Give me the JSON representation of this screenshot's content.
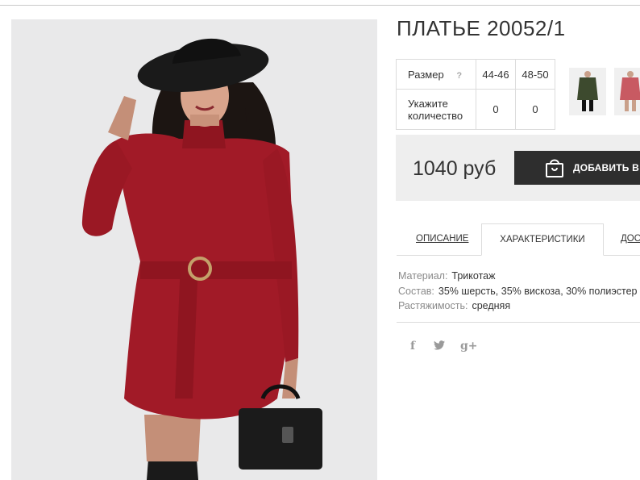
{
  "product": {
    "title": "ПЛАТЬЕ 20052/1"
  },
  "size_table": {
    "size_label": "Размер",
    "help_icon": "?",
    "sizes": [
      "44-46",
      "48-50"
    ],
    "qty_label_line1": "Укажите",
    "qty_label_line2": "количество",
    "quantities": [
      "0",
      "0"
    ]
  },
  "thumbnails": [
    {
      "name": "green-dress-thumbnail"
    },
    {
      "name": "pink-dress-thumbnail"
    }
  ],
  "price": {
    "value": "1040 руб",
    "add_to_cart_label": "ДОБАВИТЬ В ЗАКАЗ",
    "button_color": "#2e2e2e"
  },
  "tabs": [
    {
      "label": "ОПИСАНИЕ",
      "active": false
    },
    {
      "label": "ХАРАКТЕРИСТИКИ",
      "active": true
    },
    {
      "label": "ДОСТАВКА",
      "active": false
    }
  ],
  "specs": [
    {
      "key": "Материал:",
      "value": "Трикотаж"
    },
    {
      "key": "Состав:",
      "value": "35% шерсть, 35% вискоза, 30% полиэстер"
    },
    {
      "key": "Растяжимость:",
      "value": "средняя"
    }
  ],
  "social": {
    "facebook": "f",
    "twitter": "twitter-icon",
    "googleplus": "g+"
  },
  "colors": {
    "dress": "#a11a27",
    "background": "#e9e9ea"
  }
}
